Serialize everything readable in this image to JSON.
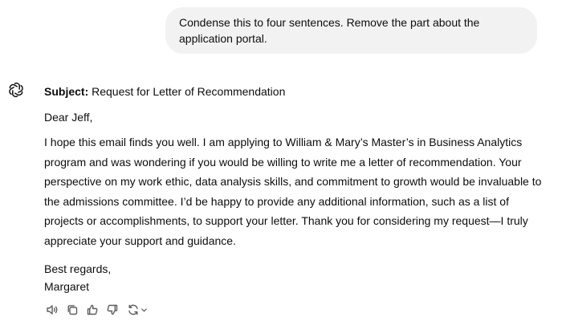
{
  "user_message": {
    "text": "Condense this to four sentences. Remove the part about the application portal."
  },
  "assistant_message": {
    "subject_label": "Subject:",
    "subject_text": " Request for Letter of Recommendation",
    "greeting": "Dear Jeff,",
    "body": "I hope this email finds you well. I am applying to William & Mary’s Master’s in Business Analytics program and was wondering if you would be willing to write me a letter of recommendation. Your perspective on my work ethic, data analysis skills, and commitment to growth would be invaluable to the admissions committee. I’d be happy to provide any additional information, such as a list of projects or accomplishments, to support your letter. Thank you for considering my request—I truly appreciate your support and guidance.",
    "closing": "Best regards,",
    "signature": "Margaret"
  },
  "actions": [
    {
      "icon": "speaker-icon"
    },
    {
      "icon": "copy-icon"
    },
    {
      "icon": "thumbs-up-icon"
    },
    {
      "icon": "thumbs-down-icon"
    },
    {
      "icon": "regenerate-icon"
    }
  ],
  "colors": {
    "bubble_background": "#f2f2f2",
    "text": "#0d0d0d",
    "icon": "#5d5d5d"
  }
}
